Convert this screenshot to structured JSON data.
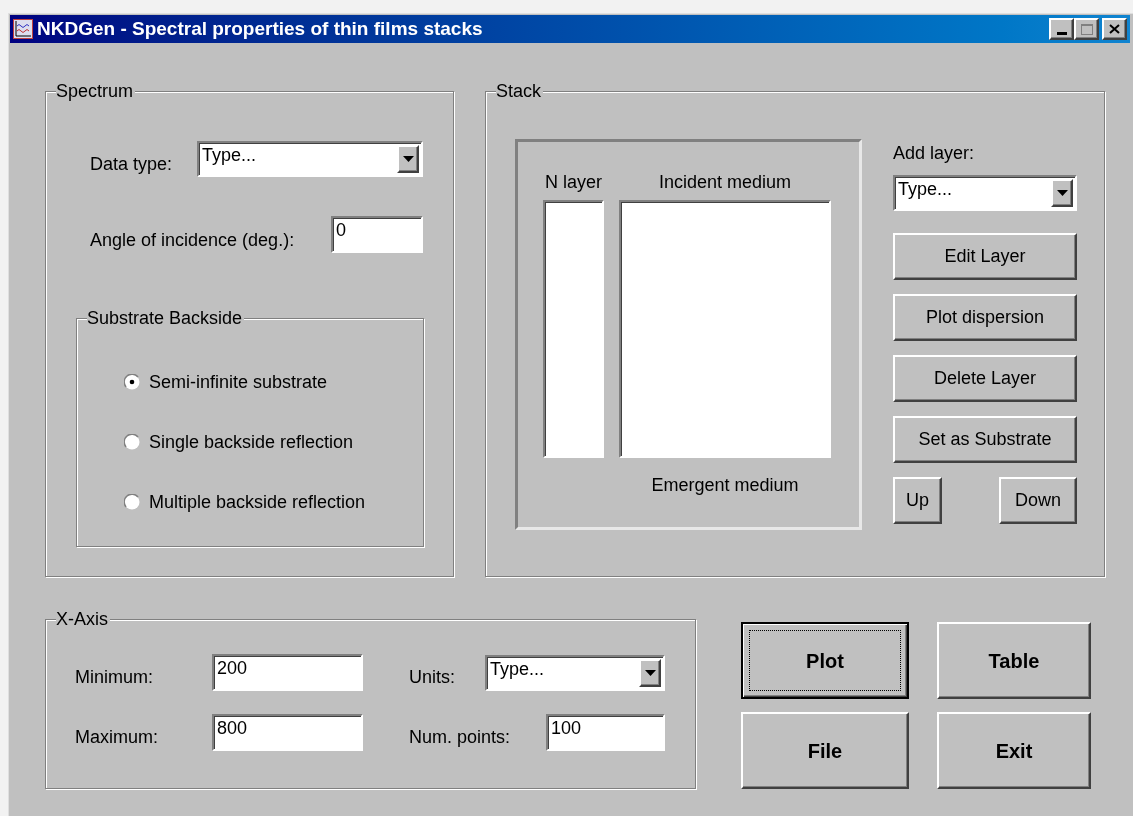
{
  "window": {
    "title": "NKDGen - Spectral properties of thin films stacks"
  },
  "spectrum": {
    "legend": "Spectrum",
    "data_type": {
      "label": "Data type:",
      "value": "Type..."
    },
    "angle": {
      "label": "Angle of incidence (deg.):",
      "value": "0"
    },
    "substrate_backside": {
      "legend": "Substrate Backside",
      "options": [
        {
          "label": "Semi-infinite substrate",
          "selected": true
        },
        {
          "label": "Single backside reflection",
          "selected": false
        },
        {
          "label": "Multiple backside reflection",
          "selected": false
        }
      ]
    }
  },
  "stack": {
    "legend": "Stack",
    "n_layer_label": "N layer",
    "incident_label": "Incident medium",
    "emergent_label": "Emergent medium",
    "add_layer": {
      "label": "Add layer:",
      "value": "Type..."
    },
    "buttons": [
      "Edit Layer",
      "Plot dispersion",
      "Delete Layer",
      "Set as Substrate"
    ],
    "move_buttons": [
      "Up",
      "Down"
    ]
  },
  "x_axis": {
    "legend": "X-Axis",
    "minimum": {
      "label": "Minimum:",
      "value": "200"
    },
    "maximum": {
      "label": "Maximum:",
      "value": "800"
    },
    "units": {
      "label": "Units:",
      "value": "Type..."
    },
    "num_points": {
      "label": "Num. points:",
      "value": "100"
    }
  },
  "actions": [
    {
      "label": "Plot",
      "focused": true
    },
    {
      "label": "Table",
      "focused": false
    },
    {
      "label": "File",
      "focused": false
    },
    {
      "label": "Exit",
      "focused": false
    }
  ]
}
